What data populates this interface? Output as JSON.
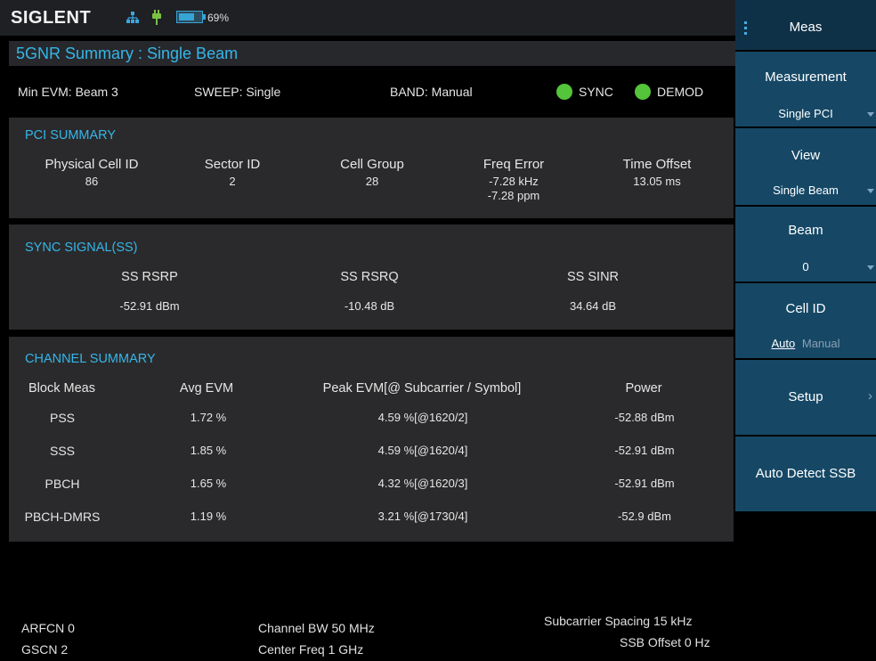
{
  "brand": "SIGLENT",
  "battery_pct": "69%",
  "battery_level": 0.69,
  "title": "5GNR Summary : Single Beam",
  "status": {
    "min_evm": "Min EVM: Beam 3",
    "sweep": "SWEEP: Single",
    "band": "BAND: Manual",
    "sync": "SYNC",
    "demod": "DEMOD"
  },
  "pci": {
    "title": "PCI SUMMARY",
    "cols": [
      {
        "label": "Physical Cell ID",
        "value": "86"
      },
      {
        "label": "Sector ID",
        "value": "2"
      },
      {
        "label": "Cell Group",
        "value": "28"
      },
      {
        "label": "Freq Error",
        "value": "-7.28 kHz",
        "value2": "-7.28 ppm"
      },
      {
        "label": "Time Offset",
        "value": "13.05 ms"
      }
    ]
  },
  "sync_signal": {
    "title": "SYNC SIGNAL(SS)",
    "cols": [
      {
        "label": "SS RSRP",
        "value": "-52.91 dBm"
      },
      {
        "label": "SS RSRQ",
        "value": "-10.48 dB"
      },
      {
        "label": "SS SINR",
        "value": "34.64 dB"
      }
    ]
  },
  "channel": {
    "title": "CHANNEL SUMMARY",
    "headers": [
      "Block Meas",
      "Avg EVM",
      "Peak EVM[@ Subcarrier / Symbol]",
      "Power"
    ],
    "rows": [
      [
        "PSS",
        "1.72 %",
        "4.59 %[@1620/2]",
        "-52.88 dBm"
      ],
      [
        "SSS",
        "1.85 %",
        "4.59 %[@1620/4]",
        "-52.91 dBm"
      ],
      [
        "PBCH",
        "1.65 %",
        "4.32 %[@1620/3]",
        "-52.91 dBm"
      ],
      [
        "PBCH-DMRS",
        "1.19 %",
        "3.21 %[@1730/4]",
        "-52.9 dBm"
      ]
    ]
  },
  "footer": {
    "arfcn": "ARFCN  0",
    "gscn": "GSCN  2",
    "channel_bw": "Channel BW  50 MHz",
    "center_freq": "Center Freq  1 GHz",
    "subcarrier_spacing": "Subcarrier Spacing  15 kHz",
    "ssb_offset": "SSB Offset  0 Hz"
  },
  "menu": {
    "header": "Meas",
    "measurement_label": "Measurement",
    "measurement_value": "Single PCI",
    "view_label": "View",
    "view_value": "Single Beam",
    "beam_label": "Beam",
    "beam_value": "0",
    "cellid_label": "Cell ID",
    "cellid_auto": "Auto",
    "cellid_manual": "Manual",
    "setup_label": "Setup",
    "auto_detect_label": "Auto Detect SSB"
  },
  "colors": {
    "accent": "#35b6e8",
    "led_green": "#54c43b",
    "menu_blue": "#164866",
    "panel_gray": "#2a2a2c"
  }
}
